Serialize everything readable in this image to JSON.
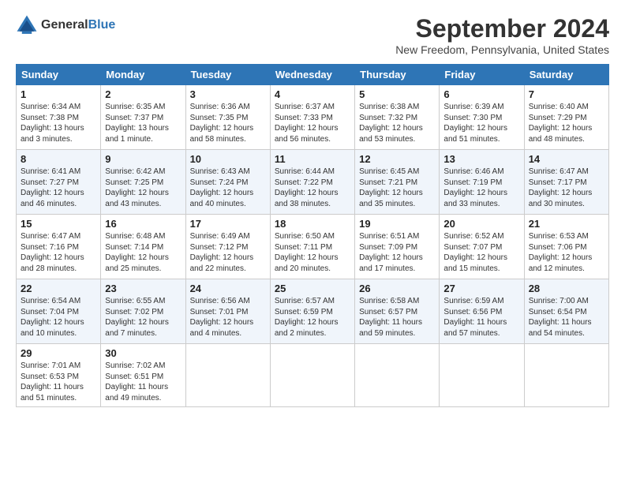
{
  "header": {
    "logo_line1": "General",
    "logo_line2": "Blue",
    "month": "September 2024",
    "location": "New Freedom, Pennsylvania, United States"
  },
  "days_of_week": [
    "Sunday",
    "Monday",
    "Tuesday",
    "Wednesday",
    "Thursday",
    "Friday",
    "Saturday"
  ],
  "weeks": [
    [
      {
        "day": "1",
        "info": "Sunrise: 6:34 AM\nSunset: 7:38 PM\nDaylight: 13 hours\nand 3 minutes."
      },
      {
        "day": "2",
        "info": "Sunrise: 6:35 AM\nSunset: 7:37 PM\nDaylight: 13 hours\nand 1 minute."
      },
      {
        "day": "3",
        "info": "Sunrise: 6:36 AM\nSunset: 7:35 PM\nDaylight: 12 hours\nand 58 minutes."
      },
      {
        "day": "4",
        "info": "Sunrise: 6:37 AM\nSunset: 7:33 PM\nDaylight: 12 hours\nand 56 minutes."
      },
      {
        "day": "5",
        "info": "Sunrise: 6:38 AM\nSunset: 7:32 PM\nDaylight: 12 hours\nand 53 minutes."
      },
      {
        "day": "6",
        "info": "Sunrise: 6:39 AM\nSunset: 7:30 PM\nDaylight: 12 hours\nand 51 minutes."
      },
      {
        "day": "7",
        "info": "Sunrise: 6:40 AM\nSunset: 7:29 PM\nDaylight: 12 hours\nand 48 minutes."
      }
    ],
    [
      {
        "day": "8",
        "info": "Sunrise: 6:41 AM\nSunset: 7:27 PM\nDaylight: 12 hours\nand 46 minutes."
      },
      {
        "day": "9",
        "info": "Sunrise: 6:42 AM\nSunset: 7:25 PM\nDaylight: 12 hours\nand 43 minutes."
      },
      {
        "day": "10",
        "info": "Sunrise: 6:43 AM\nSunset: 7:24 PM\nDaylight: 12 hours\nand 40 minutes."
      },
      {
        "day": "11",
        "info": "Sunrise: 6:44 AM\nSunset: 7:22 PM\nDaylight: 12 hours\nand 38 minutes."
      },
      {
        "day": "12",
        "info": "Sunrise: 6:45 AM\nSunset: 7:21 PM\nDaylight: 12 hours\nand 35 minutes."
      },
      {
        "day": "13",
        "info": "Sunrise: 6:46 AM\nSunset: 7:19 PM\nDaylight: 12 hours\nand 33 minutes."
      },
      {
        "day": "14",
        "info": "Sunrise: 6:47 AM\nSunset: 7:17 PM\nDaylight: 12 hours\nand 30 minutes."
      }
    ],
    [
      {
        "day": "15",
        "info": "Sunrise: 6:47 AM\nSunset: 7:16 PM\nDaylight: 12 hours\nand 28 minutes."
      },
      {
        "day": "16",
        "info": "Sunrise: 6:48 AM\nSunset: 7:14 PM\nDaylight: 12 hours\nand 25 minutes."
      },
      {
        "day": "17",
        "info": "Sunrise: 6:49 AM\nSunset: 7:12 PM\nDaylight: 12 hours\nand 22 minutes."
      },
      {
        "day": "18",
        "info": "Sunrise: 6:50 AM\nSunset: 7:11 PM\nDaylight: 12 hours\nand 20 minutes."
      },
      {
        "day": "19",
        "info": "Sunrise: 6:51 AM\nSunset: 7:09 PM\nDaylight: 12 hours\nand 17 minutes."
      },
      {
        "day": "20",
        "info": "Sunrise: 6:52 AM\nSunset: 7:07 PM\nDaylight: 12 hours\nand 15 minutes."
      },
      {
        "day": "21",
        "info": "Sunrise: 6:53 AM\nSunset: 7:06 PM\nDaylight: 12 hours\nand 12 minutes."
      }
    ],
    [
      {
        "day": "22",
        "info": "Sunrise: 6:54 AM\nSunset: 7:04 PM\nDaylight: 12 hours\nand 10 minutes."
      },
      {
        "day": "23",
        "info": "Sunrise: 6:55 AM\nSunset: 7:02 PM\nDaylight: 12 hours\nand 7 minutes."
      },
      {
        "day": "24",
        "info": "Sunrise: 6:56 AM\nSunset: 7:01 PM\nDaylight: 12 hours\nand 4 minutes."
      },
      {
        "day": "25",
        "info": "Sunrise: 6:57 AM\nSunset: 6:59 PM\nDaylight: 12 hours\nand 2 minutes."
      },
      {
        "day": "26",
        "info": "Sunrise: 6:58 AM\nSunset: 6:57 PM\nDaylight: 11 hours\nand 59 minutes."
      },
      {
        "day": "27",
        "info": "Sunrise: 6:59 AM\nSunset: 6:56 PM\nDaylight: 11 hours\nand 57 minutes."
      },
      {
        "day": "28",
        "info": "Sunrise: 7:00 AM\nSunset: 6:54 PM\nDaylight: 11 hours\nand 54 minutes."
      }
    ],
    [
      {
        "day": "29",
        "info": "Sunrise: 7:01 AM\nSunset: 6:53 PM\nDaylight: 11 hours\nand 51 minutes."
      },
      {
        "day": "30",
        "info": "Sunrise: 7:02 AM\nSunset: 6:51 PM\nDaylight: 11 hours\nand 49 minutes."
      },
      {
        "day": "",
        "info": ""
      },
      {
        "day": "",
        "info": ""
      },
      {
        "day": "",
        "info": ""
      },
      {
        "day": "",
        "info": ""
      },
      {
        "day": "",
        "info": ""
      }
    ]
  ]
}
